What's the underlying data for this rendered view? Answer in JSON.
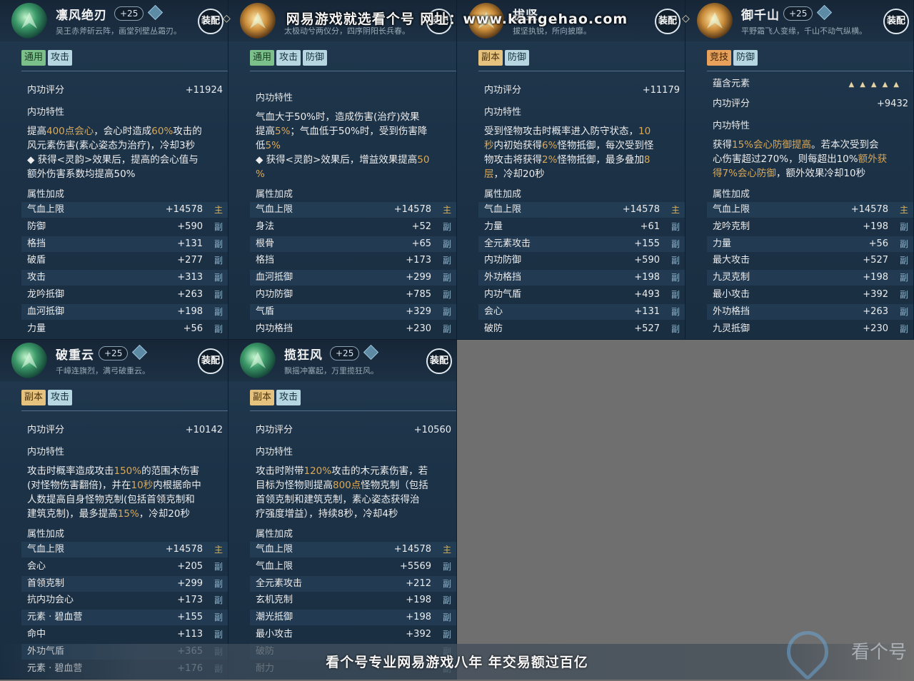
{
  "header_watermark": "网易游戏就选看个号   网址：www.kangehao.com",
  "footer_banner": "看个号专业网易游戏八年   年交易额过百亿",
  "brand_name": "看个号",
  "equip_label": "装配",
  "cards": [
    {
      "name": "凛风绝刃",
      "level": "+25",
      "flavor": "吴王赤斧斫云阵，画堂列壁丛霜刃。",
      "tags": [
        "通用",
        "攻击"
      ],
      "score_label": "内功评分",
      "score": "+11924",
      "trait_label": "内功特性",
      "desc_lines": [
        [
          [
            "提高",
            ""
          ],
          [
            "400点会心",
            "hl"
          ],
          [
            "，会心时造成",
            ""
          ],
          [
            "60%",
            "hl"
          ],
          [
            "攻击的",
            ""
          ]
        ],
        [
          [
            "风元素伤害(素心姿态为治疗)，冷却3秒",
            ""
          ]
        ],
        [
          [
            "◆ 获得<灵韵>效果后，提高的会心值与",
            ""
          ]
        ],
        [
          [
            "额外伤害系数均提高50%",
            ""
          ]
        ]
      ],
      "attr_label": "属性加成",
      "attrs": [
        {
          "k": "气血上限",
          "v": "+14578",
          "m": "主"
        },
        {
          "k": "防御",
          "v": "+590",
          "m": "副"
        },
        {
          "k": "格挡",
          "v": "+131",
          "m": "副"
        },
        {
          "k": "破盾",
          "v": "+277",
          "m": "副"
        },
        {
          "k": "攻击",
          "v": "+313",
          "m": "副"
        },
        {
          "k": "龙吟抵御",
          "v": "+263",
          "m": "副"
        },
        {
          "k": "血河抵御",
          "v": "+198",
          "m": "副"
        },
        {
          "k": "力量",
          "v": "+56",
          "m": "副"
        }
      ]
    },
    {
      "name": "",
      "level": "",
      "flavor": "太极动兮两仪分，四序阴阳长兵春。",
      "tags": [
        "通用",
        "攻击",
        "防御"
      ],
      "score_label": "",
      "score": "",
      "trait_label": "内功特性",
      "desc_lines": [
        [
          [
            "气血大于50%时，造成伤害(治疗)效果",
            ""
          ]
        ],
        [
          [
            "提高",
            ""
          ],
          [
            "5%",
            "hl"
          ],
          [
            "；气血低于50%时，受到伤害降",
            ""
          ]
        ],
        [
          [
            "低",
            ""
          ],
          [
            "5%",
            "hl"
          ]
        ],
        [
          [
            "◆ 获得<灵韵>效果后，增益效果提高",
            ""
          ],
          [
            "50",
            "hl"
          ]
        ],
        [
          [
            "%",
            "hl"
          ]
        ]
      ],
      "attr_label": "属性加成",
      "attrs": [
        {
          "k": "气血上限",
          "v": "+14578",
          "m": "主"
        },
        {
          "k": "身法",
          "v": "+52",
          "m": "副"
        },
        {
          "k": "根骨",
          "v": "+65",
          "m": "副"
        },
        {
          "k": "格挡",
          "v": "+173",
          "m": "副"
        },
        {
          "k": "血河抵御",
          "v": "+299",
          "m": "副"
        },
        {
          "k": "内功防御",
          "v": "+785",
          "m": "副"
        },
        {
          "k": "气盾",
          "v": "+329",
          "m": "副"
        },
        {
          "k": "内功格挡",
          "v": "+230",
          "m": "副"
        }
      ]
    },
    {
      "name": "拔坚",
      "level": "",
      "flavor": "拔坚执锐，所向披靡。",
      "tags": [
        "副本",
        "防御"
      ],
      "score_label": "内功评分",
      "score": "+11179",
      "trait_label": "内功特性",
      "desc_lines": [
        [
          [
            "受到怪物攻击时概率进入防守状态，",
            ""
          ],
          [
            "10",
            "hl"
          ]
        ],
        [
          [
            "秒",
            "hl"
          ],
          [
            "内初始获得",
            ""
          ],
          [
            "6%",
            "hl"
          ],
          [
            "怪物抵御，每次受到怪",
            ""
          ]
        ],
        [
          [
            "物攻击将获得",
            ""
          ],
          [
            "2%",
            "hl"
          ],
          [
            "怪物抵御，最多叠加",
            ""
          ],
          [
            "8",
            "hl"
          ]
        ],
        [
          [
            "层",
            "hl"
          ],
          [
            "，冷却20秒",
            ""
          ]
        ]
      ],
      "attr_label": "属性加成",
      "attrs": [
        {
          "k": "气血上限",
          "v": "+14578",
          "m": "主"
        },
        {
          "k": "力量",
          "v": "+61",
          "m": "副"
        },
        {
          "k": "全元素攻击",
          "v": "+155",
          "m": "副"
        },
        {
          "k": "内功防御",
          "v": "+590",
          "m": "副"
        },
        {
          "k": "外功格挡",
          "v": "+198",
          "m": "副"
        },
        {
          "k": "内功气盾",
          "v": "+493",
          "m": "副"
        },
        {
          "k": "会心",
          "v": "+131",
          "m": "副"
        },
        {
          "k": "破防",
          "v": "+527",
          "m": "副"
        }
      ]
    },
    {
      "name": "御千山",
      "level": "+25",
      "flavor": "平野霜飞人变缘，千山不动气纵横。",
      "tags": [
        "竞技",
        "防御"
      ],
      "element_label": "蕴含元素",
      "score_label": "内功评分",
      "score": "+9432",
      "trait_label": "内功特性",
      "desc_lines": [
        [
          [
            "获得",
            ""
          ],
          [
            "15%会心防御提高",
            "hl"
          ],
          [
            "。若本次受到会",
            ""
          ]
        ],
        [
          [
            "心伤害超过270%，则每超出10%",
            ""
          ],
          [
            "额外获",
            "hl"
          ]
        ],
        [
          [
            "得7%会心防御",
            "hl"
          ],
          [
            "，额外效果冷却10秒",
            ""
          ]
        ]
      ],
      "attr_label": "属性加成",
      "attrs": [
        {
          "k": "气血上限",
          "v": "+14578",
          "m": "主"
        },
        {
          "k": "龙吟克制",
          "v": "+198",
          "m": "副"
        },
        {
          "k": "力量",
          "v": "+56",
          "m": "副"
        },
        {
          "k": "最大攻击",
          "v": "+527",
          "m": "副"
        },
        {
          "k": "九灵克制",
          "v": "+198",
          "m": "副"
        },
        {
          "k": "最小攻击",
          "v": "+392",
          "m": "副"
        },
        {
          "k": "外功格挡",
          "v": "+263",
          "m": "副"
        },
        {
          "k": "九灵抵御",
          "v": "+230",
          "m": "副"
        }
      ]
    },
    {
      "name": "破重云",
      "level": "+25",
      "flavor": "千嶂连旗烈，满弓破重云。",
      "tags": [
        "副本",
        "攻击"
      ],
      "score_label": "内功评分",
      "score": "+10142",
      "trait_label": "内功特性",
      "desc_lines": [
        [
          [
            "攻击时概率造成攻击",
            ""
          ],
          [
            "150%",
            "hl"
          ],
          [
            "的范围木伤害",
            ""
          ]
        ],
        [
          [
            "(对怪物伤害翻倍)，并在",
            ""
          ],
          [
            "10秒",
            "hl"
          ],
          [
            "内根据命中",
            ""
          ]
        ],
        [
          [
            "人数提高自身怪物克制(包括首领克制和",
            ""
          ]
        ],
        [
          [
            "建筑克制)，最多提高",
            ""
          ],
          [
            "15%",
            "hl"
          ],
          [
            "，冷却20秒",
            ""
          ]
        ]
      ],
      "attr_label": "属性加成",
      "attrs": [
        {
          "k": "气血上限",
          "v": "+14578",
          "m": "主"
        },
        {
          "k": "会心",
          "v": "+205",
          "m": "副"
        },
        {
          "k": "首领克制",
          "v": "+299",
          "m": "副"
        },
        {
          "k": "抗内功会心",
          "v": "+173",
          "m": "副"
        },
        {
          "k": "元素 · 碧血营",
          "v": "+155",
          "m": "副"
        },
        {
          "k": "命中",
          "v": "+113",
          "m": "副"
        },
        {
          "k": "外功气盾",
          "v": "+365",
          "m": "副"
        },
        {
          "k": "元素 · 碧血营",
          "v": "+176",
          "m": "副"
        }
      ]
    },
    {
      "name": "揽狂风",
      "level": "+25",
      "flavor": "飘摇冲塞起，万里揽狂风。",
      "tags": [
        "副本",
        "攻击"
      ],
      "score_label": "内功评分",
      "score": "+10560",
      "trait_label": "内功特性",
      "desc_lines": [
        [
          [
            "攻击时附带",
            ""
          ],
          [
            "120%",
            "hl"
          ],
          [
            "攻击的木元素伤害，若",
            ""
          ]
        ],
        [
          [
            "目标为怪物则提高",
            ""
          ],
          [
            "800点",
            "hl"
          ],
          [
            "怪物克制（包括",
            ""
          ]
        ],
        [
          [
            "首领克制和建筑克制，素心姿态获得治",
            ""
          ]
        ],
        [
          [
            "疗强度增益），持续8秒，冷却4秒",
            ""
          ]
        ]
      ],
      "attr_label": "属性加成",
      "attrs": [
        {
          "k": "气血上限",
          "v": "+14578",
          "m": "主"
        },
        {
          "k": "气血上限",
          "v": "+5569",
          "m": "副"
        },
        {
          "k": "全元素攻击",
          "v": "+212",
          "m": "副"
        },
        {
          "k": "玄机克制",
          "v": "+198",
          "m": "副"
        },
        {
          "k": "潮光抵御",
          "v": "+198",
          "m": "副"
        },
        {
          "k": "最小攻击",
          "v": "+392",
          "m": "副"
        },
        {
          "k": "破防",
          "v": "",
          "m": "副"
        },
        {
          "k": "耐力",
          "v": "",
          "m": "副"
        }
      ]
    }
  ]
}
